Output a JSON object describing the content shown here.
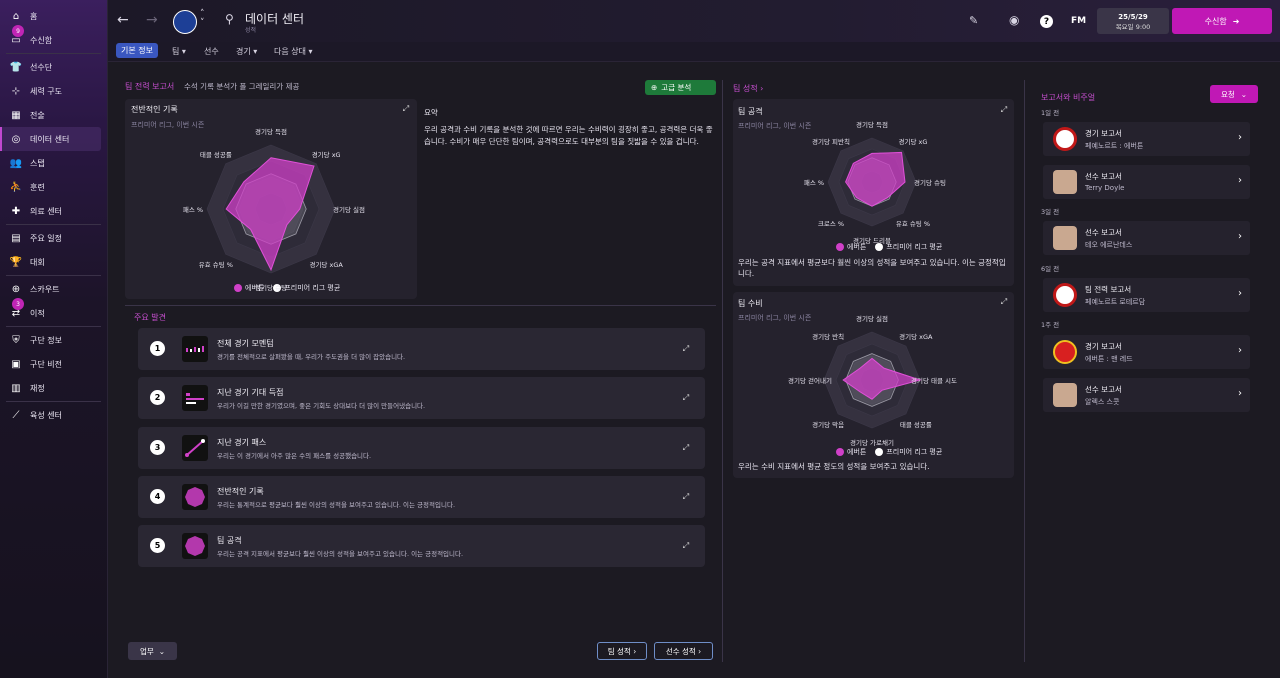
{
  "sidebar": {
    "items": [
      {
        "label": "홈",
        "icon": "home-icon"
      },
      {
        "label": "수신함",
        "icon": "inbox-icon",
        "badge": "9"
      },
      {
        "label": "선수단",
        "icon": "shirt-icon"
      },
      {
        "label": "세력 구도",
        "icon": "dynamics-icon"
      },
      {
        "label": "전술",
        "icon": "tactics-icon"
      },
      {
        "label": "데이터 센터",
        "icon": "data-hub-icon",
        "active": true
      },
      {
        "label": "스탭",
        "icon": "staff-icon"
      },
      {
        "label": "훈련",
        "icon": "training-icon"
      },
      {
        "label": "의료 센터",
        "icon": "medical-icon"
      },
      {
        "label": "주요 일정",
        "icon": "calendar-icon"
      },
      {
        "label": "대회",
        "icon": "trophy-icon"
      },
      {
        "label": "스카우트",
        "icon": "scouting-icon"
      },
      {
        "label": "이적",
        "icon": "transfers-icon",
        "badge": "3"
      },
      {
        "label": "구단 정보",
        "icon": "shield-icon"
      },
      {
        "label": "구단 비전",
        "icon": "vision-icon"
      },
      {
        "label": "재정",
        "icon": "finance-icon"
      },
      {
        "label": "육성 센터",
        "icon": "development-icon"
      }
    ]
  },
  "header": {
    "title": "데이터 센터",
    "subtitle": "성적",
    "date": "25/5/29",
    "time": "목요일 9:00",
    "continue_label": "수신함",
    "fm_label": "FM"
  },
  "subnav": {
    "tabs": [
      "기본 정보",
      "팀",
      "선수",
      "경기",
      "다음 상대"
    ]
  },
  "team_report": {
    "heading": "팀 전력 보고서",
    "heading_note": "수석 기록 분석가 폴 그레일리가 제공",
    "advanced_label": "고급 분석",
    "overall": {
      "title": "전반적인 기록",
      "subtitle": "프리미어 리그, 이번 시즌",
      "labels": [
        "경기당 득점",
        "경기당 xG",
        "경기당 실점",
        "경기당 xGA",
        "경기당 슈팅",
        "유효 슈팅 %",
        "패스 %",
        "태클 성공률"
      ],
      "legend_team": "에버튼",
      "legend_avg": "프리미어 리그 평균"
    },
    "summary_title": "요약",
    "summary_text": "우리 공격과 수비 기록을 분석한 것에 따르면 우리는 수비력이 굉장히 좋고, 공격력은 더욱 좋습니다. 수비가 매우 단단한 팀이며, 공격력으로도 대부분의 팀을 짓밟을 수 있을 겁니다."
  },
  "findings": {
    "heading": "주요 발견",
    "items": [
      {
        "num": "1",
        "title": "전체 경기 모멘텀",
        "desc": "경기를 전체적으로 살펴봤을 때, 우리가 주도권을 더 많이 잡았습니다."
      },
      {
        "num": "2",
        "title": "지난 경기 기대 득점",
        "desc": "우리가 이길 만한 경기였으며, 좋은 기회도 상대보다 더 많이 만들어냈습니다."
      },
      {
        "num": "3",
        "title": "지난 경기 패스",
        "desc": "우리는 이 경기에서 아주 많은 수의 패스를 성공했습니다."
      },
      {
        "num": "4",
        "title": "전반적인 기록",
        "desc": "우리는 통계적으로 평균보다 훨씬 이상의 성적을 보여주고 있습니다. 이는 긍정적입니다."
      },
      {
        "num": "5",
        "title": "팀 공격",
        "desc": "우리는 공격 지표에서 평균보다 훨씬 이상의 성적을 보여주고 있습니다. 이는 긍정적입니다."
      }
    ]
  },
  "footer": {
    "work_label": "업무",
    "team_stats_btn": "팀 성적",
    "player_stats_btn": "선수 성적"
  },
  "team_stats": {
    "heading": "팀 성적",
    "attack": {
      "title": "팀 공격",
      "subtitle": "프리미어 리그, 이번 시즌",
      "labels": [
        "경기당 득점",
        "경기당 xG",
        "경기당 슈팅",
        "유효 슈팅 %",
        "경기당 드리블",
        "크로스 %",
        "패스 %",
        "경기당 피반칙"
      ],
      "legend_team": "에버튼",
      "legend_avg": "프리미어 리그 평균",
      "note": "우리는 공격 지표에서 평균보다 훨씬 이상의 성적을 보여주고 있습니다. 이는 긍정적입니다."
    },
    "defense": {
      "title": "팀 수비",
      "subtitle": "프리미어 리그, 이번 시즌",
      "labels": [
        "경기당 실점",
        "경기당 xGA",
        "경기당 태클 시도",
        "태클 성공률",
        "경기당 가로채기",
        "경기당 막음",
        "경기당 걷어내기",
        "경기당 반칙"
      ],
      "legend_team": "에버튼",
      "legend_avg": "프리미어 리그 평균",
      "note": "우리는 수비 지표에서 평균 정도의 성적을 보여주고 있습니다."
    }
  },
  "reports": {
    "heading": "보고서와 비주얼",
    "request_label": "요청",
    "groups": [
      {
        "time": "1일 전",
        "items": [
          {
            "title": "경기 보고서",
            "sub": "페예노르트 : 에버튼",
            "badge": "feyenoord-badge"
          },
          {
            "title": "선수 보고서",
            "sub": "Terry Doyle",
            "badge": "player-face"
          }
        ]
      },
      {
        "time": "3일 전",
        "items": [
          {
            "title": "선수 보고서",
            "sub": "테오 에르난데스",
            "badge": "player-face"
          }
        ]
      },
      {
        "time": "6일 전",
        "items": [
          {
            "title": "팀 전력 보고서",
            "sub": "페예노르트 로테르담",
            "badge": "feyenoord-badge"
          }
        ]
      },
      {
        "time": "1주 전",
        "items": [
          {
            "title": "경기 보고서",
            "sub": "에버튼 : 맨 레드",
            "badge": "man-red-badge"
          },
          {
            "title": "선수 보고서",
            "sub": "알렉스 스콧",
            "badge": "player-face"
          }
        ]
      }
    ]
  },
  "colors": {
    "accent": "#c018b5",
    "team": "#d040c8",
    "avg": "#ffffff",
    "link": "#c74fd0"
  }
}
